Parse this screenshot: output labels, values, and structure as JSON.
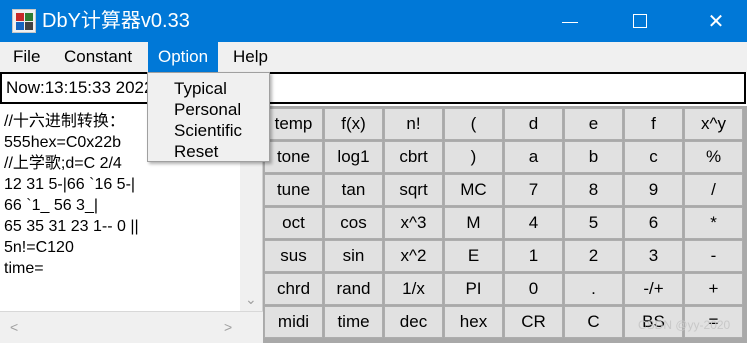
{
  "window": {
    "title": "DbY计算器v0.33",
    "minimize_icon": "minimize-icon",
    "maximize_icon": "maximize-icon",
    "close_glyph": "✕"
  },
  "menu": {
    "items": [
      "File",
      "Constant",
      "Option",
      "Help"
    ],
    "active": "Option"
  },
  "input": {
    "value": "Now:13:15:33 2022-05-29"
  },
  "option_menu": {
    "items": [
      "Typical",
      "Personal",
      "Scientific",
      "Reset"
    ]
  },
  "output": {
    "lines": [
      "//十六进制转换：",
      "555hex=C0x22b",
      "//上学歌;d=C 2/4",
      "12 31 5-|66 `16 5-|",
      "66 `1_ 56 3_|",
      "65 35 31 23 1-- 0 ||",
      "5n!=C120",
      "time="
    ]
  },
  "keypad": {
    "rows": [
      [
        "temp",
        "f(x)",
        "n!",
        "(",
        "d",
        "e",
        "f",
        "x^y"
      ],
      [
        "tone",
        "log1",
        "cbrt",
        ")",
        "a",
        "b",
        "c",
        "%"
      ],
      [
        "tune",
        "tan",
        "sqrt",
        "MC",
        "7",
        "8",
        "9",
        "/"
      ],
      [
        "oct",
        "cos",
        "x^3",
        "M",
        "4",
        "5",
        "6",
        "*"
      ],
      [
        "sus",
        "sin",
        "x^2",
        "E",
        "1",
        "2",
        "3",
        "-"
      ],
      [
        "chrd",
        "rand",
        "1/x",
        "PI",
        "0",
        ".",
        "-/+",
        "+"
      ],
      [
        "midi",
        "time",
        "dec",
        "hex",
        "CR",
        "C",
        "BS",
        "="
      ]
    ]
  },
  "watermark": "CSDN @yy-2020",
  "colors": {
    "titlebar": "#0078d7",
    "menu_highlight": "#0078d7",
    "key_face": "#e1e1e1",
    "keypad_bg": "#a9a9a9"
  }
}
